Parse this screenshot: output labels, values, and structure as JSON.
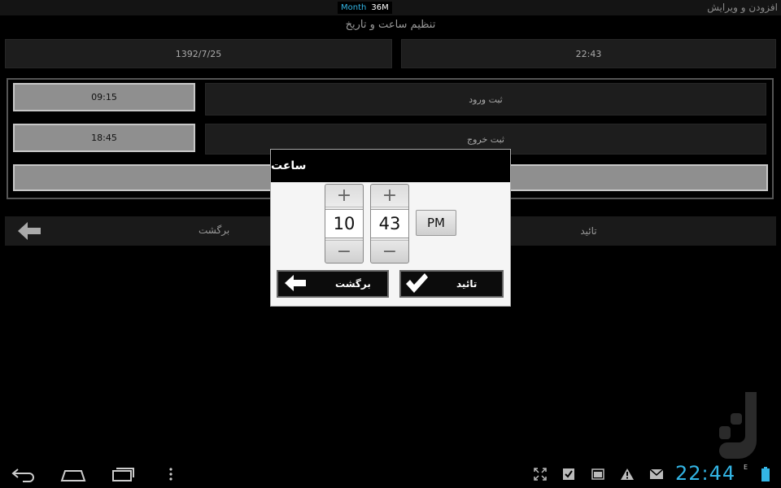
{
  "statusbar": {
    "title": "افزودن و ویرایش",
    "month_label": "Month",
    "size_label": "36M"
  },
  "form": {
    "heading": "تنظیم ساعت و تاریخ",
    "date_value": "1392/7/25",
    "time_value": "22:43",
    "entry_time": "09:15",
    "entry_label": "ثبت ورود",
    "exit_time": "18:45",
    "exit_label": "ثبت خروج",
    "back_label": "برگشت",
    "confirm_label": "تائید"
  },
  "dialog": {
    "title": "ساعت",
    "hour": "10",
    "minute": "43",
    "ampm": "PM",
    "plus_symbol": "+",
    "minus_symbol": "−",
    "back_label": "برگشت",
    "confirm_label": "تائید"
  },
  "navbar": {
    "clock": "22:44",
    "battery_label": "E"
  },
  "colors": {
    "accent": "#33b5e5",
    "background": "#000000",
    "field_dark": "#1d1d1d",
    "field_light": "#8f8f8f"
  },
  "icons": [
    "back-icon",
    "home-icon",
    "recent-apps-icon",
    "menu-icon",
    "fullscreen-icon",
    "task-icon",
    "picture-icon",
    "warning-icon",
    "gmail-icon",
    "battery-icon",
    "arrow-left-icon",
    "checkmark-icon"
  ]
}
